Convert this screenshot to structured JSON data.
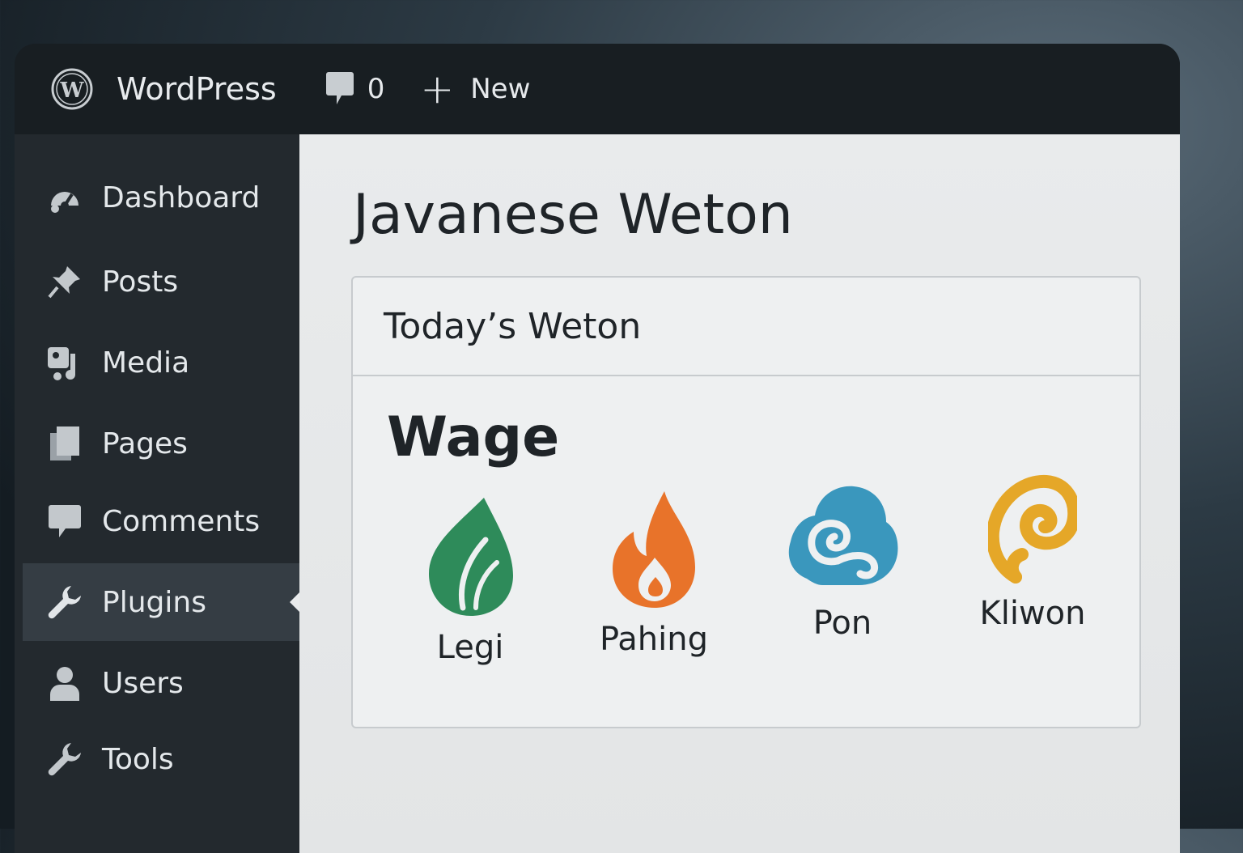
{
  "adminbar": {
    "site_name": "WordPress",
    "comments_count": "0",
    "new_label": "New",
    "icons": [
      "wordpress-logo-icon",
      "comment-bubble-icon",
      "plus-icon"
    ]
  },
  "sidebar": {
    "items": [
      {
        "label": "Dashboard",
        "icon": "dashboard-icon"
      },
      {
        "label": "Posts",
        "icon": "pin-icon"
      },
      {
        "label": "Media",
        "icon": "media-icon"
      },
      {
        "label": "Pages",
        "icon": "pages-icon"
      },
      {
        "label": "Comments",
        "icon": "comment-icon"
      },
      {
        "label": "Plugins",
        "icon": "plugin-wrench-icon",
        "active": true
      },
      {
        "label": "Users",
        "icon": "user-icon"
      },
      {
        "label": "Tools",
        "icon": "tools-wrench-icon"
      }
    ]
  },
  "main": {
    "page_title": "Javanese Weton",
    "card": {
      "title": "Today’s Weton",
      "day": "Wage",
      "pasaran": [
        {
          "label": "Legi",
          "icon": "leaf-icon",
          "color": "#2e8b5a"
        },
        {
          "label": "Pahing",
          "icon": "flame-icon",
          "color": "#e8732a"
        },
        {
          "label": "Pon",
          "icon": "cloud-swirl-icon",
          "color": "#3a97bd"
        },
        {
          "label": "Kliwon",
          "icon": "spiral-icon",
          "color": "#e5a728"
        }
      ]
    }
  }
}
